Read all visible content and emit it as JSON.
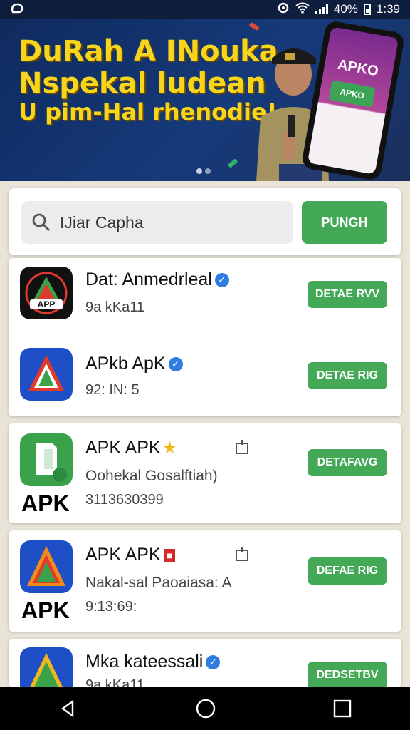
{
  "status": {
    "percent": "40%",
    "time": "1:39"
  },
  "banner": {
    "line1": "DuRah A INouka",
    "line2": "Nspekal ludean",
    "line3": "U pim-Hal rhenodie!",
    "phone_logo": "APKO",
    "phone_green": "APKO"
  },
  "search": {
    "value": "IJiar Capha",
    "button_label": "PUNGH"
  },
  "apps": [
    {
      "title": "Dat: Anmedrleal",
      "meta": "9a kKa11",
      "button": "DETAE RVV",
      "icon_text": "APP"
    },
    {
      "title": "APkb ApK",
      "meta": "92: IN: 5",
      "button": "DETAE RIG"
    },
    {
      "title": "APK APK",
      "subtitle": "Oohekal Gosalftiah)",
      "meta": "3113630399",
      "button": "DETAFAVG",
      "caption": "APK"
    },
    {
      "title": "APK APK",
      "subtitle": "Nakal-sal Paoaiasa: A",
      "meta": "9:13:69:",
      "button": "DEFAE RIG",
      "caption": "APK"
    },
    {
      "title": "Mka kateessali",
      "meta": "9a kKa11",
      "button": "DEDSETBV"
    }
  ],
  "colors": {
    "accent_green": "#43a957",
    "banner_yellow": "#f7d51d",
    "navy": "#0f2a5e"
  }
}
